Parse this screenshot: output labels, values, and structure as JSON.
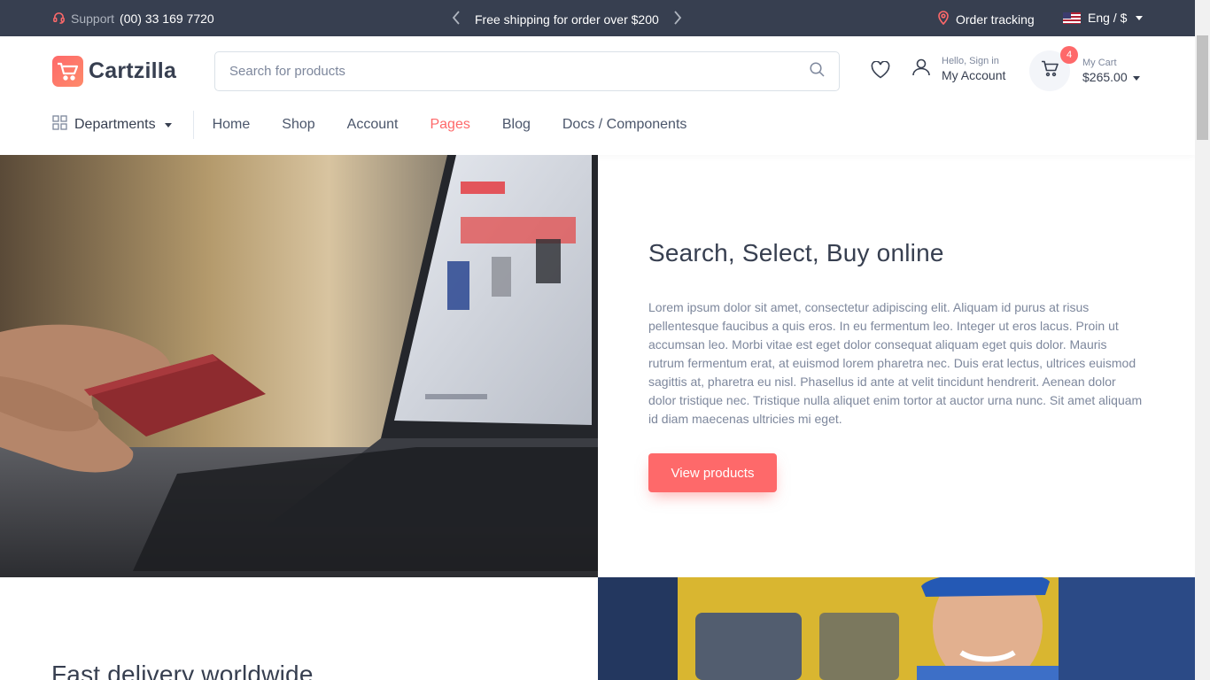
{
  "topbar": {
    "support_label": "Support",
    "support_phone": "(00) 33 169 7720",
    "promo_text": "Free shipping for order over $200",
    "order_tracking": "Order tracking",
    "language": "Eng / $"
  },
  "header": {
    "logo_text": "Cartzilla",
    "search_placeholder": "Search for products",
    "account_greeting": "Hello, Sign in",
    "account_label": "My Account",
    "cart_count": "4",
    "cart_label": "My Cart",
    "cart_total": "$265.00"
  },
  "nav": {
    "departments": "Departments",
    "links": [
      {
        "label": "Home"
      },
      {
        "label": "Shop"
      },
      {
        "label": "Account"
      },
      {
        "label": "Pages"
      },
      {
        "label": "Blog"
      },
      {
        "label": "Docs / Components"
      }
    ]
  },
  "section1": {
    "title": "Search, Select, Buy online",
    "body": "Lorem ipsum dolor sit amet, consectetur adipiscing elit. Aliquam id purus at risus pellentesque faucibus a quis eros. In eu fermentum leo. Integer ut eros lacus. Proin ut accumsan leo. Morbi vitae est eget dolor consequat aliquam eget quis dolor. Mauris rutrum fermentum erat, at euismod lorem pharetra nec. Duis erat lectus, ultrices euismod sagittis at, pharetra eu nisl. Phasellus id ante at velit tincidunt hendrerit. Aenean dolor dolor tristique nec. Tristique nulla aliquet enim tortor at auctor urna nunc. Sit amet aliquam id diam maecenas ultricies mi eget.",
    "button": "View products"
  },
  "section2": {
    "title": "Fast delivery worldwide"
  },
  "colors": {
    "accent": "#fe696a",
    "topbar_bg": "#373f50",
    "text_dark": "#373f50",
    "text_muted": "#7d879c"
  }
}
